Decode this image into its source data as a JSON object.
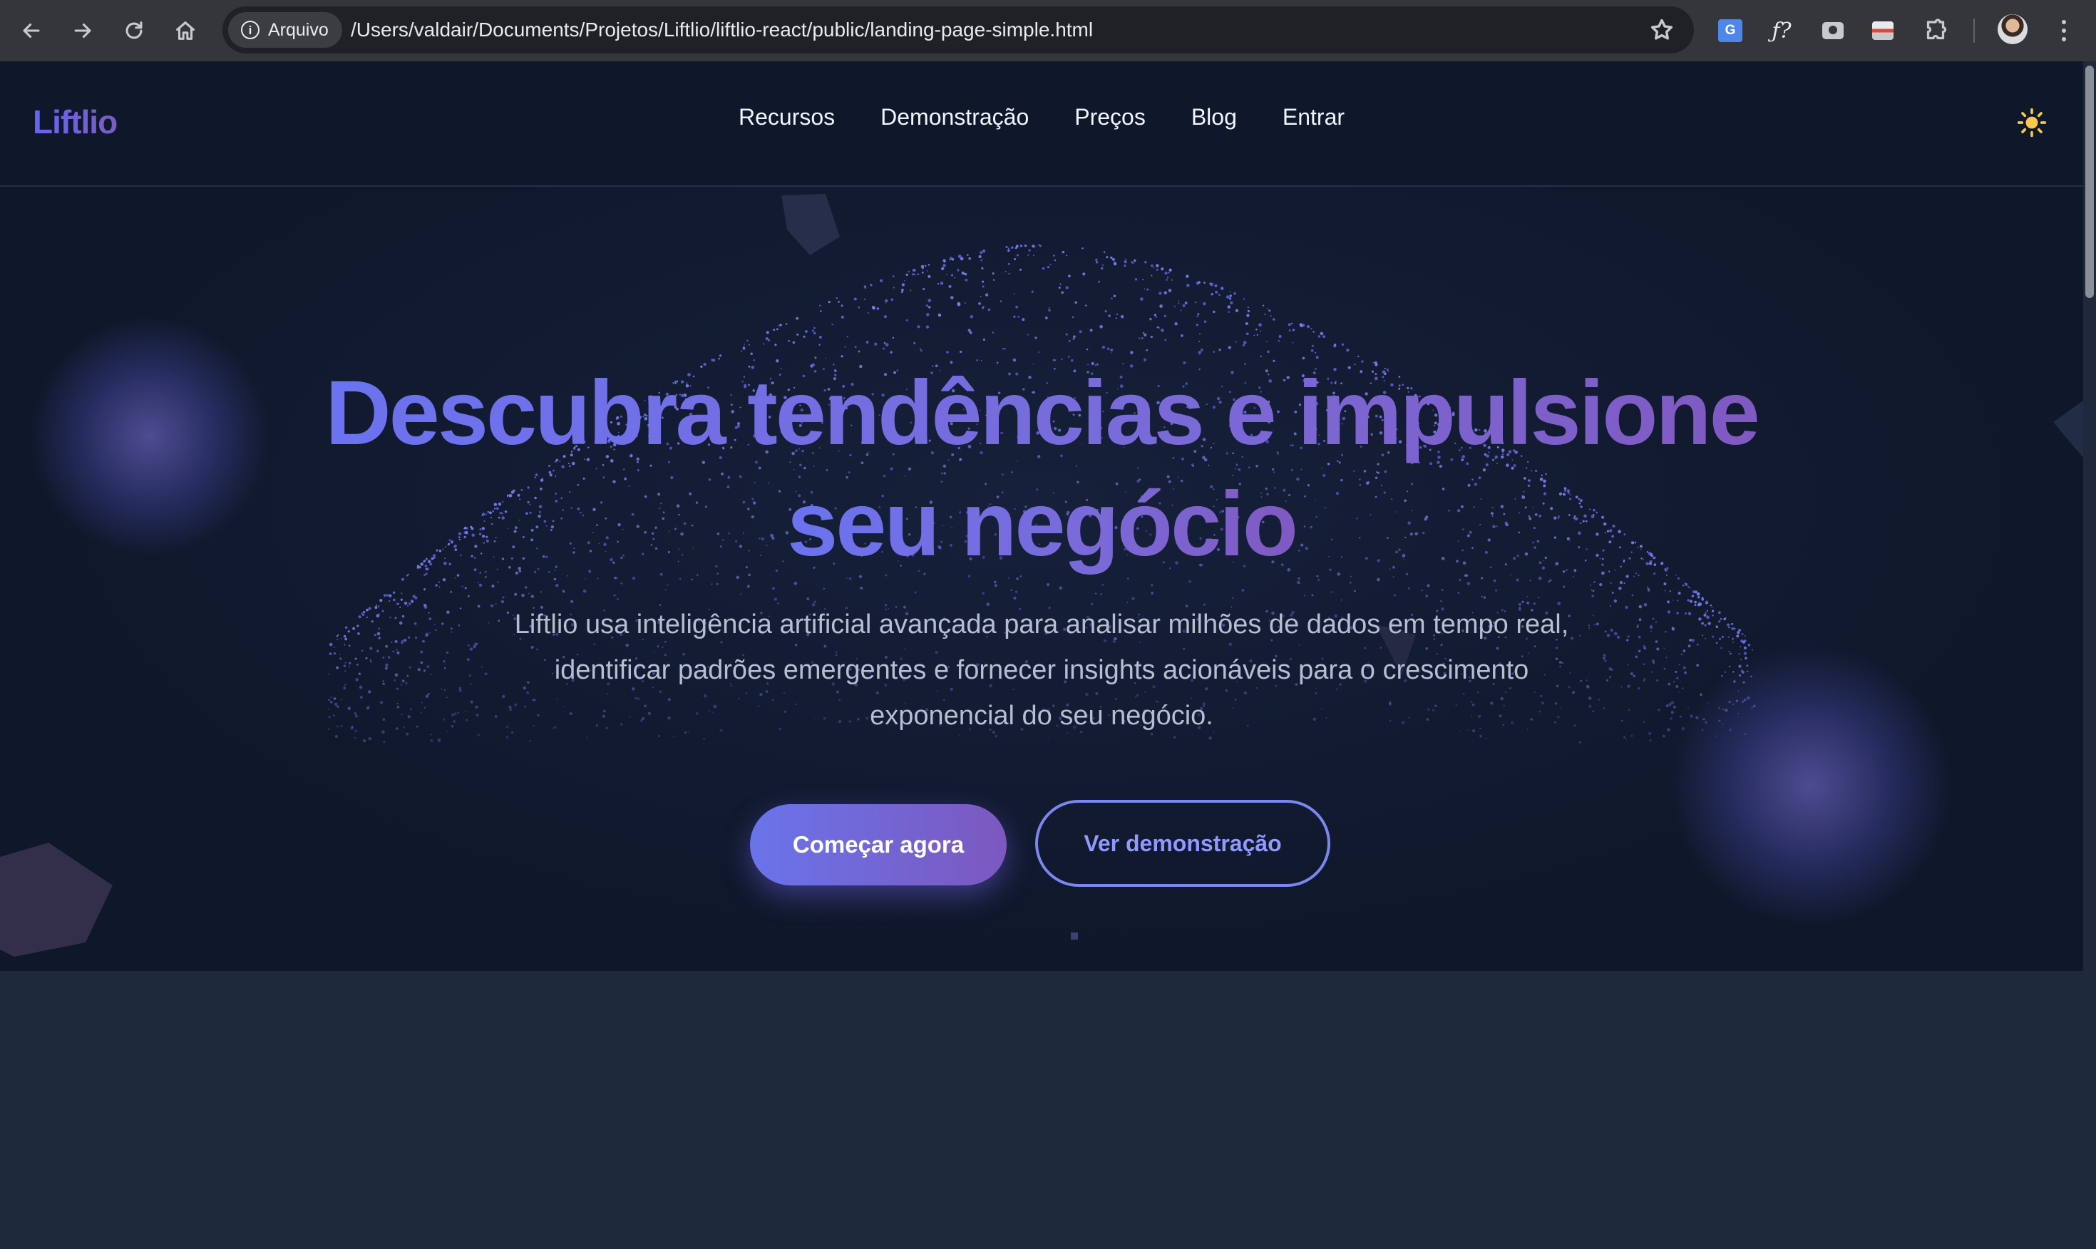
{
  "browser": {
    "site_chip": "Arquivo",
    "url": "/Users/valdair/Documents/Projetos/Liftlio/liftlio-react/public/landing-page-simple.html",
    "extensions": [
      "google-translate-icon",
      "fx-icon",
      "camera-icon",
      "window-icon",
      "puzzle-icon"
    ],
    "translate_label": "G"
  },
  "header": {
    "logo": "Liftlio",
    "nav": [
      "Recursos",
      "Demonstração",
      "Preços",
      "Blog",
      "Entrar"
    ],
    "theme_icon": "sun-icon"
  },
  "hero": {
    "title_line1": "Descubra tendências e impulsione",
    "title_line2": "seu negócio",
    "subtitle_line1": "Liftlio usa inteligência artificial avançada para analisar milhões de dados em tempo real,",
    "subtitle_line2": "identificar padrões emergentes e fornecer insights acionáveis para o crescimento",
    "subtitle_line3": "exponencial do seu negócio.",
    "primary_cta": "Começar agora",
    "secondary_cta": "Ver demonstração"
  },
  "colors": {
    "accent_start": "#6366f1",
    "accent_end": "#7c58bf",
    "hero_bg": "#0f172a",
    "page_bg": "#1e293b"
  }
}
